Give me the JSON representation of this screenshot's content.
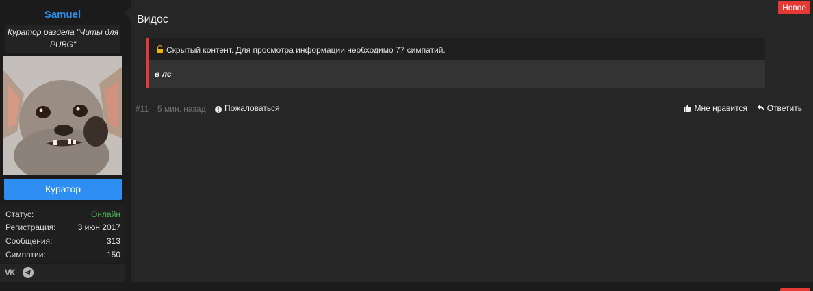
{
  "user": {
    "name": "Samuel",
    "title": "Куратор раздела \"Читы для PUBG\"",
    "role_button": "Куратор",
    "stats": [
      {
        "label": "Статус:",
        "value": "Онлайн"
      },
      {
        "label": "Регистрация:",
        "value": "3 июн 2017"
      },
      {
        "label": "Сообщения:",
        "value": "313"
      },
      {
        "label": "Симпатии:",
        "value": "150"
      }
    ],
    "social": [
      {
        "icon": "vk-icon",
        "text": "VK"
      },
      {
        "icon": "telegram-icon"
      }
    ]
  },
  "post": {
    "badge": "Новое",
    "title": "Видос",
    "hidden": {
      "notice": "Скрытый контент. Для просмотра информации необходимо 77 симпатий.",
      "body": "в лс"
    },
    "meta": {
      "number": "#11",
      "time": "5 мин. назад",
      "report": "Пожаловаться"
    },
    "actions": {
      "like": "Мне нравится",
      "reply": "Ответить"
    }
  },
  "colors": {
    "accent": "#2f8ef1",
    "username": "#2b8ee6",
    "online": "#4caf50",
    "badge": "#e53935",
    "lock": "#f2b600"
  }
}
